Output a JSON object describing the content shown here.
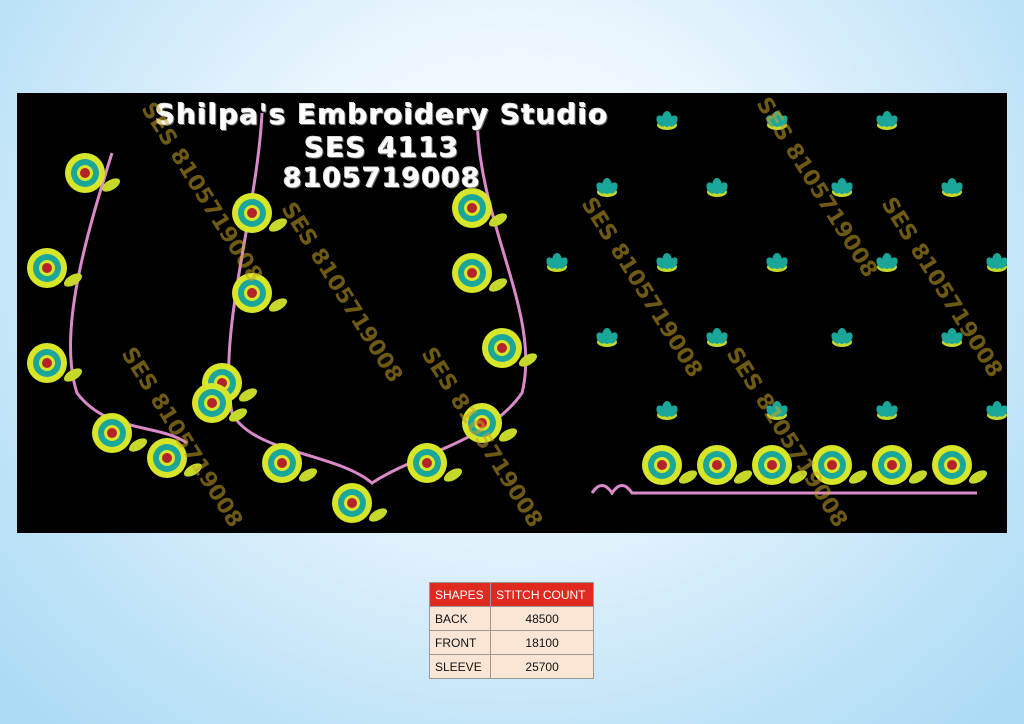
{
  "design": {
    "studio_name": "Shilpa's Embroidery Studio",
    "code": "SES 4113",
    "phone": "8105719008",
    "watermark": "SES 8105719008",
    "colors": {
      "background": "#000000",
      "flower_outer": "#d8e62a",
      "flower_mid": "#1aa79a",
      "flower_center": "#b5232a",
      "leaf": "#c6d92b",
      "border_pink": "#d98ac9"
    }
  },
  "table": {
    "headers": [
      "SHAPES",
      "STITCH COUNT"
    ],
    "rows": [
      {
        "shape": "BACK",
        "count": "48500"
      },
      {
        "shape": "FRONT",
        "count": "18100"
      },
      {
        "shape": "SLEEVE",
        "count": "25700"
      }
    ]
  }
}
